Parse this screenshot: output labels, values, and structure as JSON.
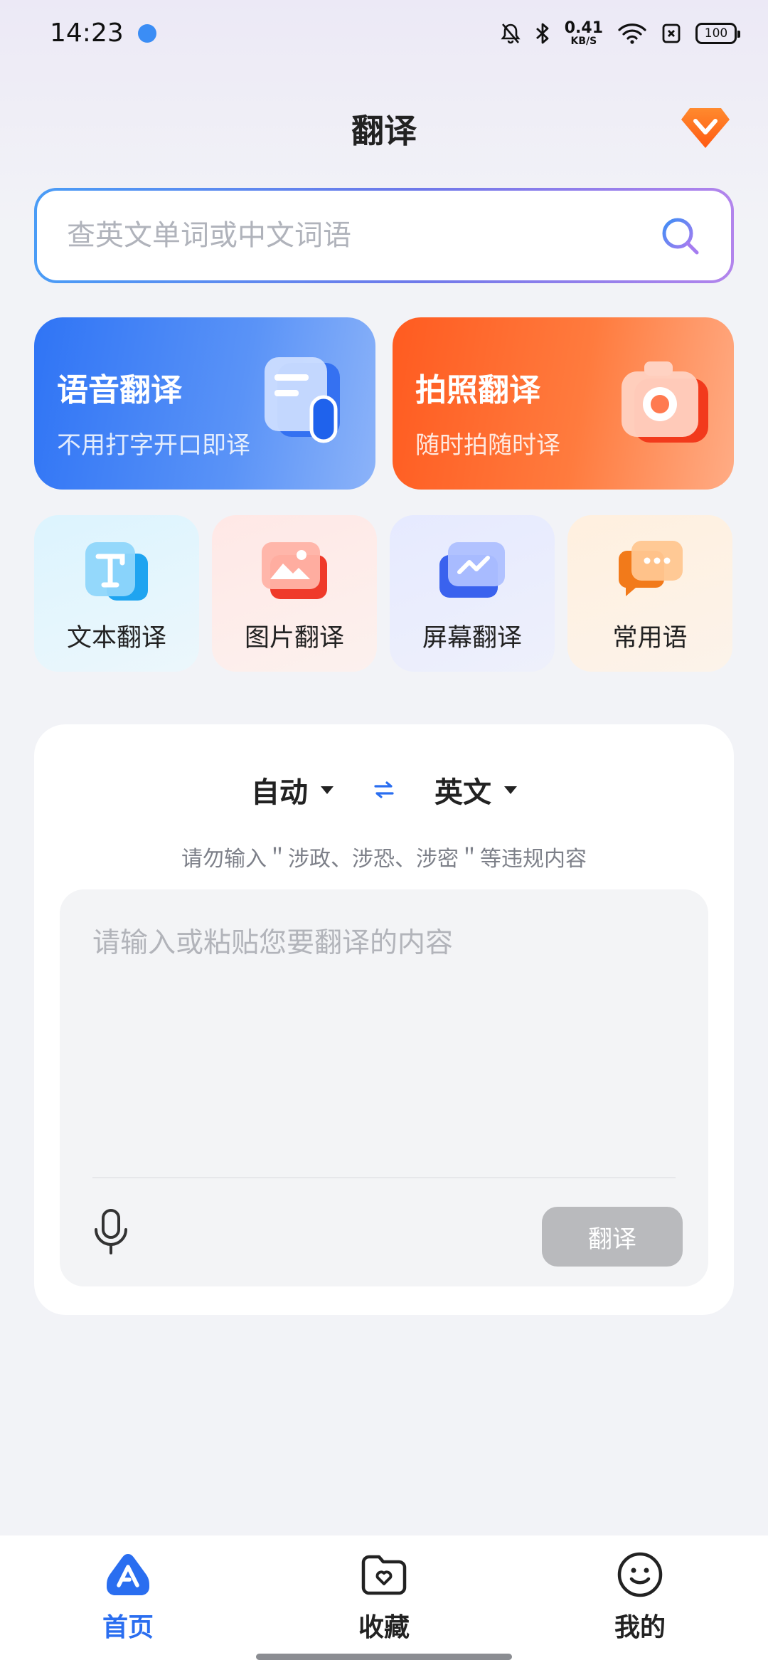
{
  "status_bar": {
    "time": "14:23",
    "net_speed_value": "0.41",
    "net_speed_unit": "KB/S",
    "battery": "100"
  },
  "header": {
    "title": "翻译"
  },
  "search": {
    "placeholder": "查英文单词或中文词语"
  },
  "big_cards": [
    {
      "title": "语音翻译",
      "subtitle": "不用打字开口即译"
    },
    {
      "title": "拍照翻译",
      "subtitle": "随时拍随时译"
    }
  ],
  "small_cards": [
    {
      "label": "文本翻译"
    },
    {
      "label": "图片翻译"
    },
    {
      "label": "屏幕翻译"
    },
    {
      "label": "常用语"
    }
  ],
  "translator": {
    "source_lang": "自动",
    "target_lang": "英文",
    "notice": "请勿输入＂涉政、涉恐、涉密＂等违规内容",
    "input_placeholder": "请输入或粘贴您要翻译的内容",
    "translate_button": "翻译"
  },
  "bottom_nav": [
    {
      "label": "首页",
      "active": true
    },
    {
      "label": "收藏",
      "active": false
    },
    {
      "label": "我的",
      "active": false
    }
  ],
  "colors": {
    "accent_blue": "#2a6ef0",
    "voice_card": "#2f74f5",
    "photo_card": "#ff5b20",
    "vip_orange": "#ff6a1a",
    "disabled_button": "#b9babd"
  }
}
